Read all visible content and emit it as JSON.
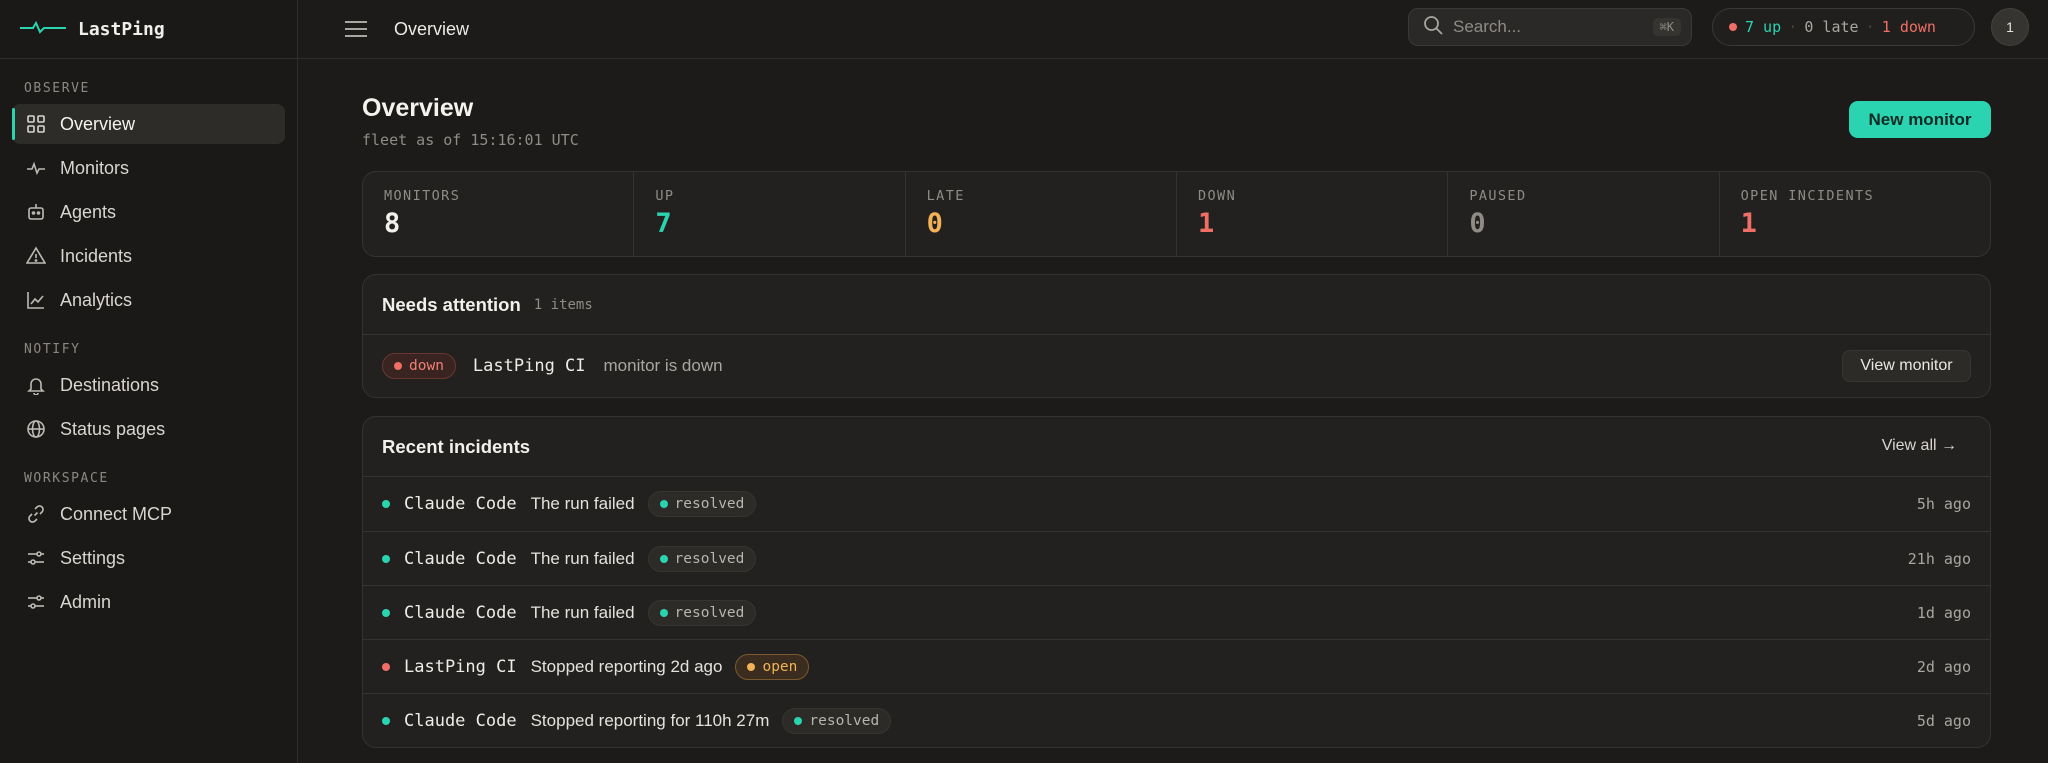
{
  "app": {
    "name": "LastPing"
  },
  "sidebar": {
    "sections": [
      {
        "label": "OBSERVE"
      },
      {
        "label": "NOTIFY"
      },
      {
        "label": "WORKSPACE"
      }
    ],
    "items": [
      {
        "label": "Overview",
        "icon": "grid-icon",
        "active": true
      },
      {
        "label": "Monitors",
        "icon": "pulse-icon"
      },
      {
        "label": "Agents",
        "icon": "bot-icon"
      },
      {
        "label": "Incidents",
        "icon": "warning-icon"
      },
      {
        "label": "Analytics",
        "icon": "chart-line-icon"
      },
      {
        "label": "Destinations",
        "icon": "bell-icon"
      },
      {
        "label": "Status pages",
        "icon": "globe-icon"
      },
      {
        "label": "Connect MCP",
        "icon": "link-icon"
      },
      {
        "label": "Settings",
        "icon": "sliders-icon"
      },
      {
        "label": "Admin",
        "icon": "sliders-icon"
      }
    ]
  },
  "header": {
    "breadcrumb": "Overview",
    "search": {
      "placeholder": "Search...",
      "shortcut": "⌘K"
    },
    "status": {
      "up": "7 up",
      "late": "0 late",
      "down": "1 down"
    },
    "avatar": "1"
  },
  "page": {
    "title": "Overview",
    "subtitle": "fleet as of 15:16:01 UTC",
    "new_button": "New monitor"
  },
  "stats": [
    {
      "label": "MONITORS",
      "value": "8",
      "color": "#f2f0eb"
    },
    {
      "label": "UP",
      "value": "7",
      "color": "#2bd4b0"
    },
    {
      "label": "LATE",
      "value": "0",
      "color": "#f2b255"
    },
    {
      "label": "DOWN",
      "value": "1",
      "color": "#ef6f66"
    },
    {
      "label": "PAUSED",
      "value": "0",
      "color": "#8f8c86"
    },
    {
      "label": "OPEN INCIDENTS",
      "value": "1",
      "color": "#ef6f66"
    }
  ],
  "attention": {
    "title": "Needs attention",
    "count": "1 items",
    "row": {
      "badge": "down",
      "monitor": "LastPing CI",
      "message": "monitor is down",
      "action": "View monitor"
    }
  },
  "incidents": {
    "title": "Recent incidents",
    "view_all": "View all →",
    "rows": [
      {
        "monitor": "Claude Code",
        "message": "The run failed",
        "status": "resolved",
        "time": "5h ago",
        "dot": "#2bd4b0"
      },
      {
        "monitor": "Claude Code",
        "message": "The run failed",
        "status": "resolved",
        "time": "21h ago",
        "dot": "#2bd4b0"
      },
      {
        "monitor": "Claude Code",
        "message": "The run failed",
        "status": "resolved",
        "time": "1d ago",
        "dot": "#2bd4b0"
      },
      {
        "monitor": "LastPing CI",
        "message": "Stopped reporting 2d ago",
        "status": "open",
        "time": "2d ago",
        "dot": "#ef6f66"
      },
      {
        "monitor": "Claude Code",
        "message": "Stopped reporting for 110h 27m",
        "status": "resolved",
        "time": "5d ago",
        "dot": "#2bd4b0"
      }
    ]
  },
  "colors": {
    "accent": "#2bd4b0",
    "danger": "#ef6f66",
    "warning": "#f2b255"
  }
}
